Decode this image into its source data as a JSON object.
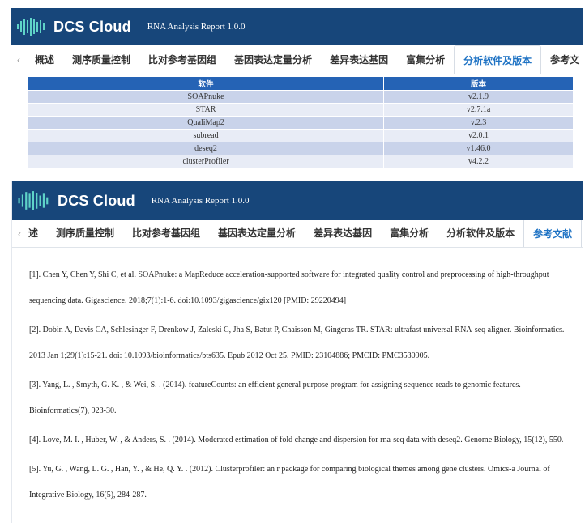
{
  "app": {
    "brand": "DCS Cloud",
    "report_title": "RNA Analysis Report 1.0.0"
  },
  "panel1": {
    "tabs": [
      {
        "label": "概述"
      },
      {
        "label": "测序质量控制"
      },
      {
        "label": "比对参考基因组"
      },
      {
        "label": "基因表达定量分析"
      },
      {
        "label": "差异表达基因"
      },
      {
        "label": "富集分析"
      },
      {
        "label": "分析软件及版本"
      },
      {
        "label": "参考文"
      }
    ],
    "active_tab": "分析软件及版本",
    "table": {
      "headers": [
        "软件",
        "版本"
      ],
      "rows": [
        [
          "SOAPnuke",
          "v2.1.9"
        ],
        [
          "STAR",
          "v2.7.1a"
        ],
        [
          "QualiMap2",
          "v.2.3"
        ],
        [
          "subread",
          "v2.0.1"
        ],
        [
          "deseq2",
          "v1.46.0"
        ],
        [
          "clusterProfiler",
          "v4.2.2"
        ]
      ]
    }
  },
  "panel2": {
    "tabs": [
      {
        "label": "述"
      },
      {
        "label": "测序质量控制"
      },
      {
        "label": "比对参考基因组"
      },
      {
        "label": "基因表达定量分析"
      },
      {
        "label": "差异表达基因"
      },
      {
        "label": "富集分析"
      },
      {
        "label": "分析软件及版本"
      },
      {
        "label": "参考文献"
      }
    ],
    "active_tab": "参考文献",
    "references": [
      "[1]. Chen Y, Chen Y, Shi C, et al. SOAPnuke: a MapReduce acceleration-supported software for integrated quality control and preprocessing of high-throughput sequencing data. Gigascience. 2018;7(1):1-6. doi:10.1093/gigascience/gix120 [PMID: 29220494]",
      "[2]. Dobin A, Davis CA, Schlesinger F, Drenkow J, Zaleski C, Jha S, Batut P, Chaisson M, Gingeras TR. STAR: ultrafast universal RNA-seq aligner. Bioinformatics. 2013 Jan 1;29(1):15-21. doi: 10.1093/bioinformatics/bts635. Epub 2012 Oct 25. PMID: 23104886; PMCID: PMC3530905.",
      "[3]. Yang, L. , Smyth, G. K. , & Wei, S. . (2014). featureCounts: an efficient general purpose program for assigning sequence reads to genomic features. Bioinformatics(7), 923-30.",
      "[4]. Love, M. I. , Huber, W. , & Anders, S. . (2014). Moderated estimation of fold change and dispersion for rna-seq data with deseq2. Genome Biology, 15(12), 550.",
      "[5]. Yu, G. , Wang, L. G. , Han, Y. , & He, Q. Y. . (2012). Clusterprofiler: an r package for comparing biological themes among gene clusters. Omics-a Journal of Integrative Biology, 16(5), 284-287."
    ]
  },
  "icons": {
    "logo": "dna-bars-logo-icon",
    "tab_prev": "chevron-left-icon",
    "tab_next": "chevron-right-icon"
  },
  "colors": {
    "header_bg": "#17467a",
    "active_tab_text": "#1f73c4",
    "table_header_bg": "#2563b5",
    "table_row_dark": "#c9d3ea",
    "table_row_light": "#e8ecf6"
  }
}
